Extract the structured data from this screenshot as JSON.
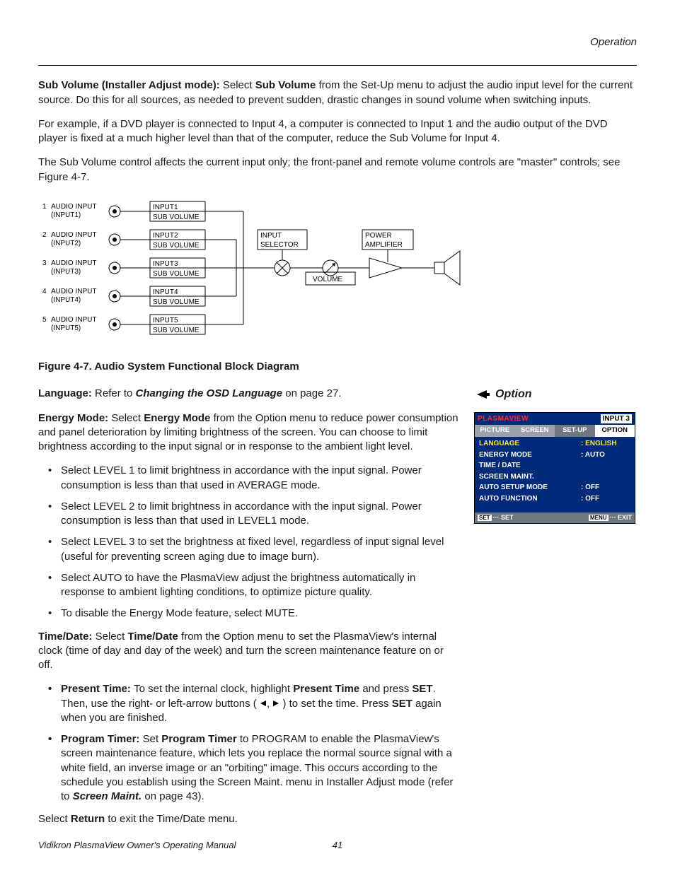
{
  "header": {
    "section": "Operation"
  },
  "para1": {
    "lead_bold": "Sub Volume (Installer Adjust mode): ",
    "select": "Select ",
    "subvol_bold": "Sub Volume",
    "rest": " from the Set-Up menu to adjust the audio input level for the current source. Do this for all sources, as needed to prevent sudden, drastic changes in sound volume when switching inputs."
  },
  "para2": "For example, if a DVD player is connected to Input 4, a computer is connected to Input 1 and the audio output of the DVD player is fixed at a much higher level than that of the computer, reduce the Sub Volume for Input 4.",
  "para3": "The Sub Volume control affects the current input only; the front-panel and remote volume controls are \"master\" controls; see Figure 4-7.",
  "diagram": {
    "inputs": [
      {
        "num": "1",
        "label": "AUDIO INPUT",
        "sub": "(INPUT1)",
        "box_top": "INPUT1",
        "box_bot": "SUB VOLUME"
      },
      {
        "num": "2",
        "label": "AUDIO INPUT",
        "sub": "(INPUT2)",
        "box_top": "INPUT2",
        "box_bot": "SUB VOLUME"
      },
      {
        "num": "3",
        "label": "AUDIO INPUT",
        "sub": "(INPUT3)",
        "box_top": "INPUT3",
        "box_bot": "SUB VOLUME"
      },
      {
        "num": "4",
        "label": "AUDIO INPUT",
        "sub": "(INPUT4)",
        "box_top": "INPUT4",
        "box_bot": "SUB VOLUME"
      },
      {
        "num": "5",
        "label": "AUDIO INPUT",
        "sub": "(INPUT5)",
        "box_top": "INPUT5",
        "box_bot": "SUB VOLUME"
      }
    ],
    "selector": "INPUT\nSELECTOR",
    "volume": "VOLUME",
    "amp": "POWER\nAMPLIFIER"
  },
  "figcaption": "Figure 4-7. Audio System Functional Block Diagram",
  "language_line": {
    "lead_bold": "Language: ",
    "refer": "Refer to ",
    "link": "Changing the OSD Language",
    "rest": " on page 27."
  },
  "energy": {
    "lead_bold": "Energy Mode: ",
    "select": "Select ",
    "em_bold": "Energy Mode",
    "rest": " from the Option menu to reduce power consumption and panel deterioration by limiting brightness of the screen. You can choose to limit brightness according to the input signal or in response to the ambient light level.",
    "bullets": [
      "Select LEVEL 1 to limit brightness in accordance with the input signal. Power consumption is less than that used in AVERAGE mode.",
      "Select LEVEL 2 to limit brightness in accordance with the input signal. Power consumption is less than that used in LEVEL1 mode.",
      "Select LEVEL 3 to set the brightness at fixed level, regardless of input signal level (useful for preventing screen aging due to image burn).",
      "Select AUTO to have the PlasmaView adjust the brightness automatically in response to ambient lighting conditions, to optimize picture quality.",
      "To disable the Energy Mode feature, select MUTE."
    ]
  },
  "timedate": {
    "lead_bold": "Time/Date: ",
    "select": "Select ",
    "td_bold": "Time/Date",
    "rest": " from the Option menu to set the PlasmaView's internal clock (time of day and day of the week) and turn the screen maintenance feature on or off.",
    "present": {
      "lead_bold": "Present Time: ",
      "t1": "To set the internal clock, highlight ",
      "pt_bold": "Present Time",
      "t2": " and press ",
      "set1": "SET",
      "t3": ". Then, use the right- or left-arrow buttons ( ",
      "t4": " ) to set the time. Press ",
      "set2": "SET",
      "t5": " again when you are finished."
    },
    "program": {
      "lead_bold": "Program Timer: ",
      "t1": "Set ",
      "pt_bold": "Program Timer",
      "t2": " to PROGRAM to enable the PlasmaView's screen maintenance feature, which lets you replace the normal source signal with a white field, an inverse image or an \"orbiting\" image. This occurs according to the schedule you establish using the Screen Maint. menu in Installer Adjust mode (refer to ",
      "sm_bold": "Screen Maint.",
      "t3": " on page 43)."
    }
  },
  "return_line": {
    "t1": "Select ",
    "ret": "Return",
    "t2": " to exit the Time/Date menu."
  },
  "side": {
    "heading": "Option",
    "osd": {
      "brand": "PLASMAVIEW",
      "input": "INPUT 3",
      "tabs": [
        "PICTURE",
        "SCREEN",
        "SET-UP",
        "OPTION"
      ],
      "rows": [
        {
          "k": "LANGUAGE",
          "v": ":  ENGLISH",
          "hl": true
        },
        {
          "k": "ENERGY MODE",
          "v": ":  AUTO"
        },
        {
          "k": "TIME / DATE",
          "v": ""
        },
        {
          "k": "SCREEN MAINT.",
          "v": ""
        },
        {
          "k": "AUTO SETUP MODE",
          "v": ":  OFF"
        },
        {
          "k": "AUTO FUNCTION",
          "v": ":  OFF"
        }
      ],
      "foot_left_btn": "SET",
      "foot_left": "··· SET",
      "foot_right_btn": "MENU",
      "foot_right": "··· EXIT"
    }
  },
  "footer": {
    "left": "Vidikron PlasmaView Owner's Operating Manual",
    "page": "41"
  }
}
